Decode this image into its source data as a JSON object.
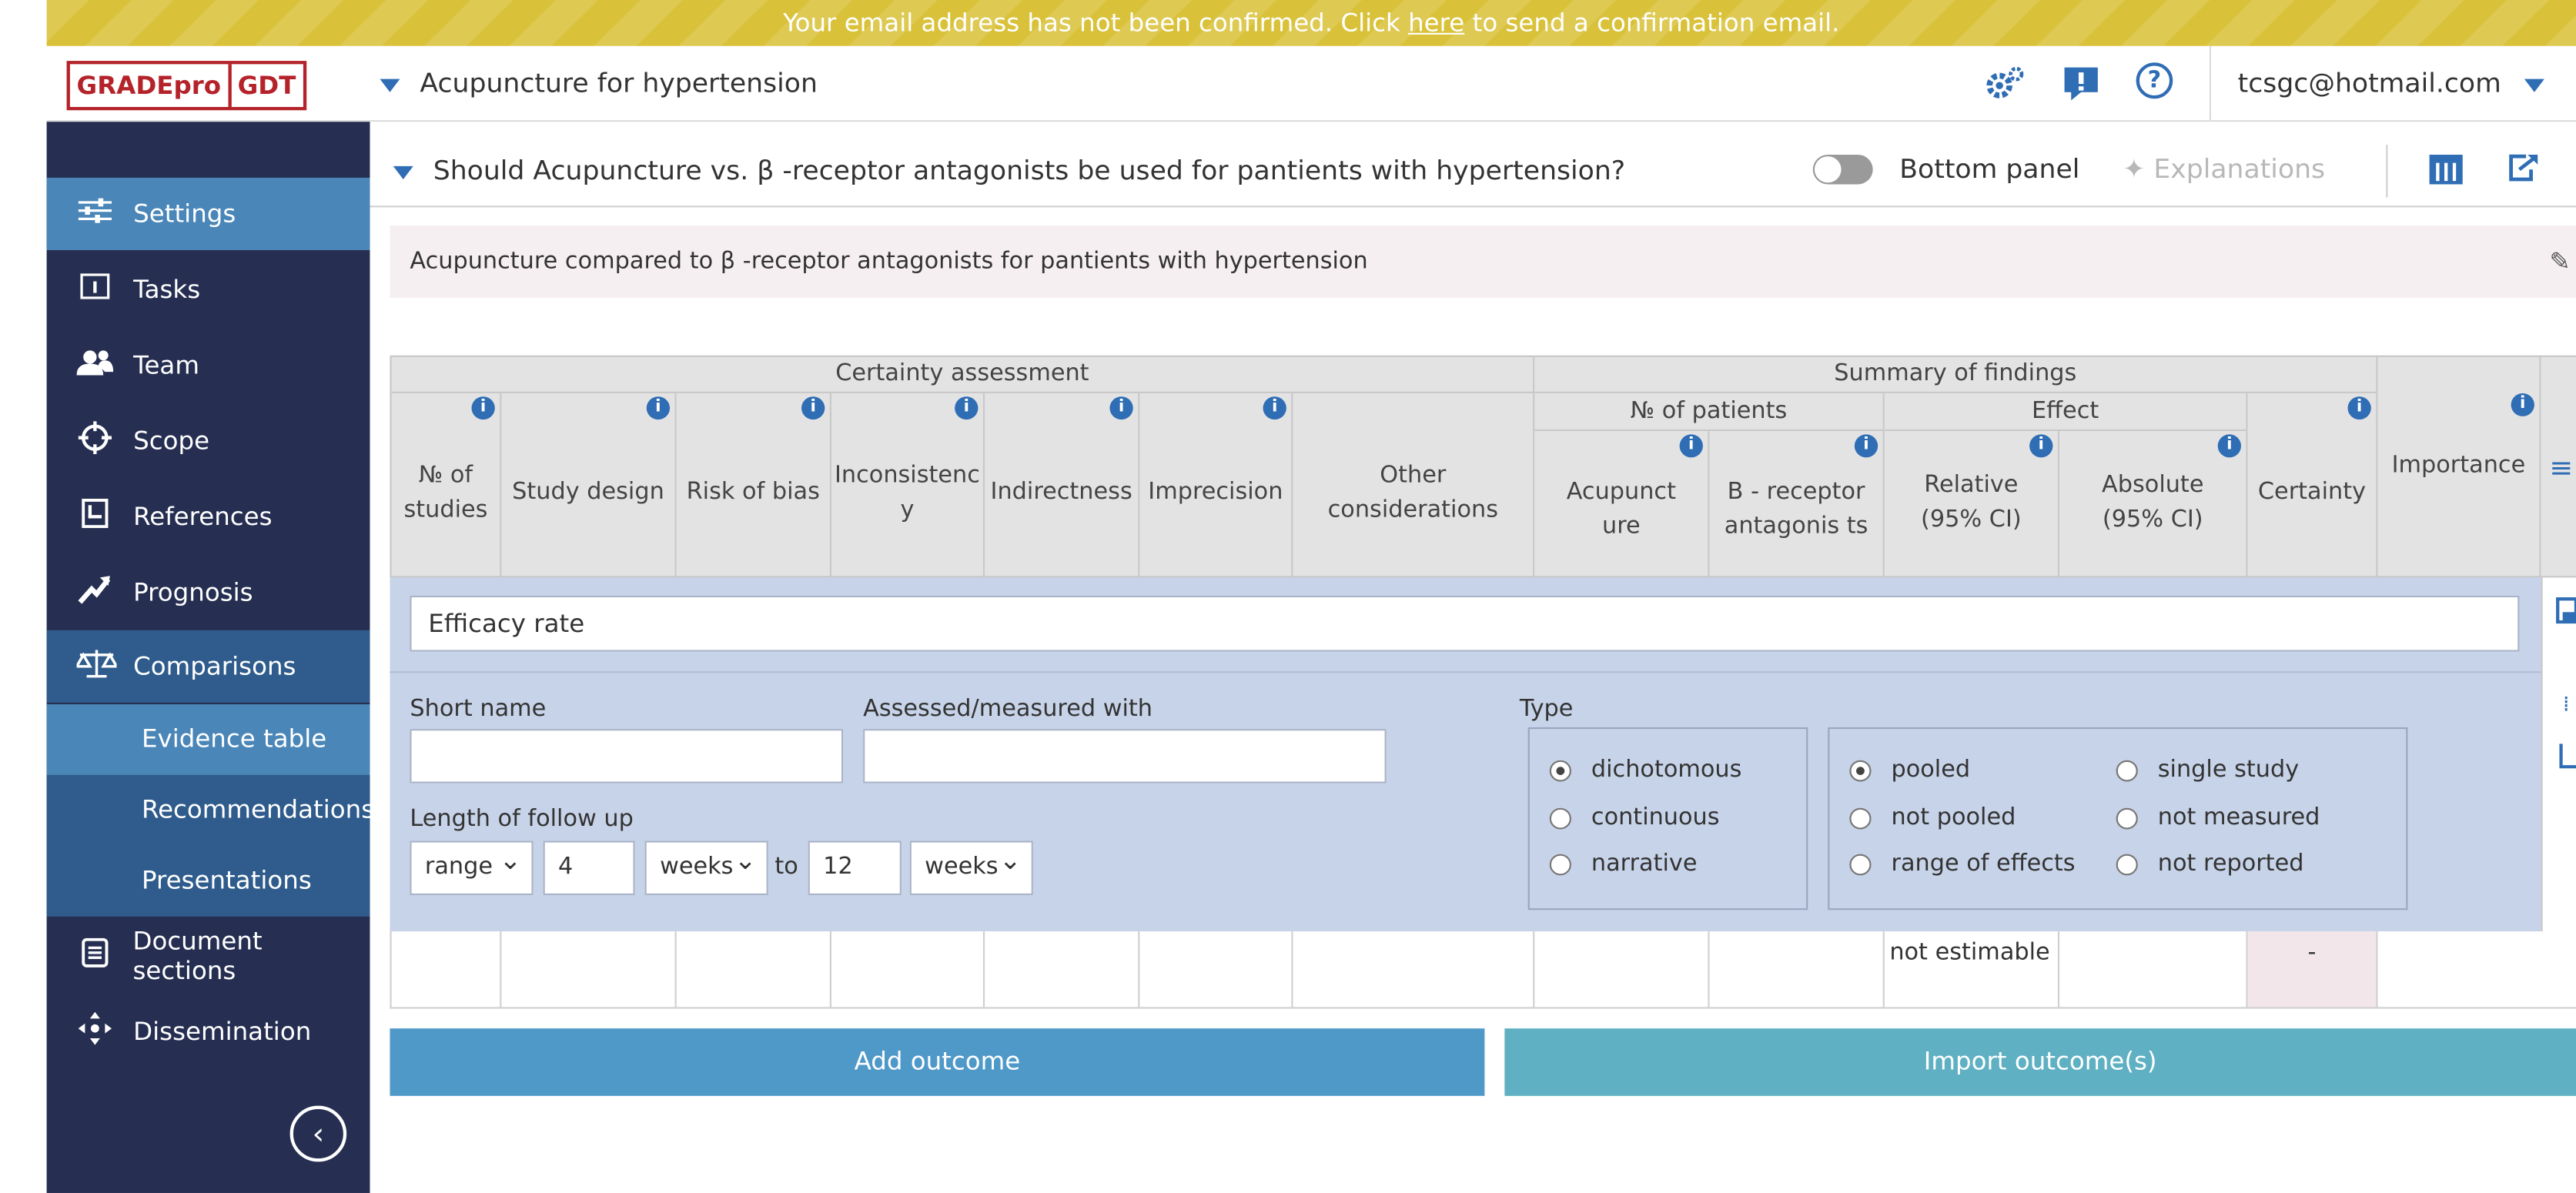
{
  "banner": {
    "text_before": "Your email address has not been confirmed. Click ",
    "link": "here",
    "text_after": " to send a confirmation email."
  },
  "header": {
    "logo_left": "GRADEpro",
    "logo_right": "GDT",
    "project": "Acupuncture for hypertension",
    "user": "tcsgc@hotmail.com",
    "icons": [
      "settings-icon",
      "alert-icon",
      "help-icon"
    ],
    "help_glyph": "?"
  },
  "sidebar": {
    "items": [
      {
        "label": "Settings",
        "icon": "sliders-icon"
      },
      {
        "label": "Tasks",
        "icon": "calendar-icon"
      },
      {
        "label": "Team",
        "icon": "team-icon"
      },
      {
        "label": "Scope",
        "icon": "crosshair-icon"
      },
      {
        "label": "References",
        "icon": "book-icon"
      },
      {
        "label": "Prognosis",
        "icon": "trend-icon"
      },
      {
        "label": "Comparisons",
        "icon": "scales-icon"
      },
      {
        "label": "Document sections",
        "icon": "document-icon"
      },
      {
        "label": "Dissemination",
        "icon": "dissemination-icon"
      }
    ],
    "sub_items": [
      "Evidence table",
      "Recommendations",
      "Presentations"
    ]
  },
  "question": {
    "text": "Should Acupuncture vs. β -receptor antagonists be used for pantients with hypertension?",
    "bottom_panel": "Bottom panel",
    "explanations": "Explanations"
  },
  "table": {
    "title": "Acupuncture compared to β -receptor antagonists for pantients with hypertension",
    "group_certainty": "Certainty assessment",
    "group_summary": "Summary of findings",
    "group_patients": "№ of patients",
    "group_effect": "Effect",
    "columns": {
      "studies": "№ of studies",
      "design": "Study design",
      "bias": "Risk of bias",
      "inconsistency": "Inconsistenc y",
      "indirectness": "Indirectness",
      "imprecision": "Imprecision",
      "other": "Other considerations",
      "acupuncture": "Acupunct ure",
      "receptor": "Β - receptor antagonis ts",
      "relative": "Relative (95% CI)",
      "absolute": "Absolute (95% CI)",
      "certainty": "Certainty",
      "importance": "Importance"
    }
  },
  "outcome": {
    "name": "Efficacy rate",
    "short_name_label": "Short name",
    "short_name_value": "",
    "assessed_label": "Assessed/measured with",
    "assessed_value": "",
    "followup_label": "Length of follow up",
    "range": "range",
    "from": "4",
    "from_unit": "weeks",
    "to_label": "to",
    "to": "12",
    "to_unit": "weeks",
    "type_label": "Type",
    "type_options": [
      "dichotomous",
      "continuous",
      "narrative"
    ],
    "type_selected": "dichotomous",
    "pool_options": [
      "pooled",
      "not pooled",
      "range of effects",
      "single study",
      "not measured",
      "not reported"
    ],
    "pool_selected": "pooled",
    "relative_value": "not estimable",
    "certainty_value": "-"
  },
  "buttons": {
    "add": "Add outcome",
    "import": "Import outcome(s)"
  }
}
